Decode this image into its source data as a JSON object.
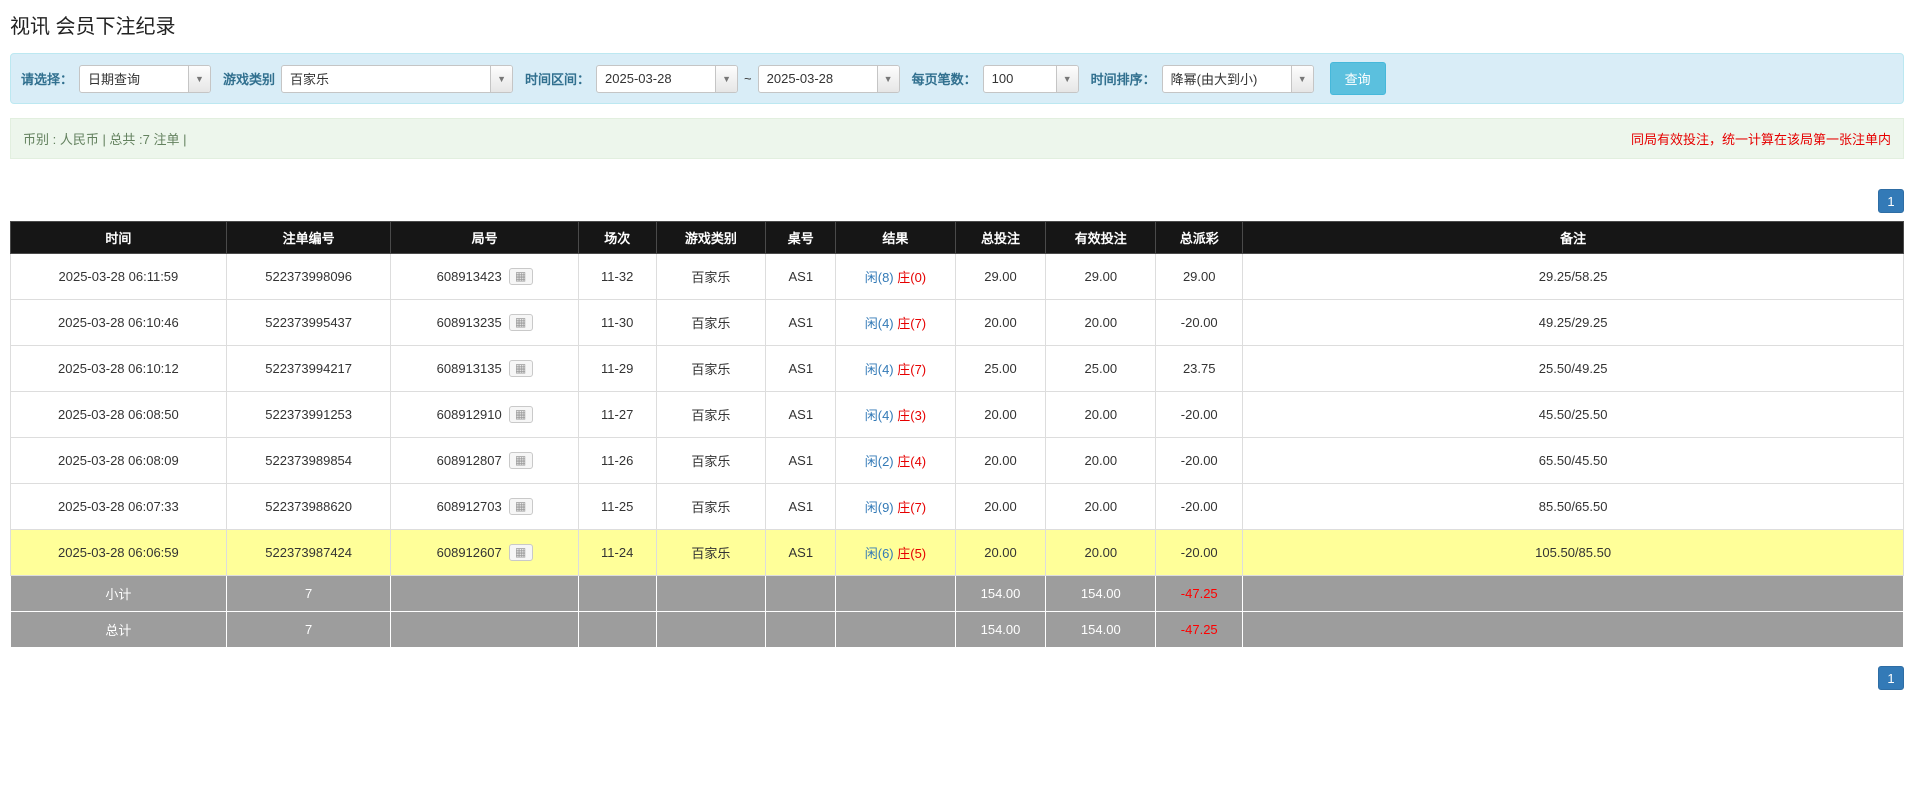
{
  "page": {
    "title": "视讯 会员下注纪录"
  },
  "filters": {
    "select_label": "请选择：",
    "select_value": "日期查询",
    "game_type_label": "游戏类别",
    "game_type_value": "百家乐",
    "time_range_label": "时间区间：",
    "date_from": "2025-03-28",
    "date_to": "2025-03-28",
    "range_separator": "~",
    "page_size_label": "每页笔数：",
    "page_size_value": "100",
    "sort_label": "时间排序：",
    "sort_value": "降幂(由大到小)",
    "query_button": "查询",
    "dropdown_icon": "▼"
  },
  "summary": {
    "left": "币别 : 人民币 | 总共 :7 注单 |",
    "right": "同局有效投注，统一计算在该局第一张注单内"
  },
  "pagination": {
    "page": "1"
  },
  "table": {
    "headers": [
      "时间",
      "注单编号",
      "局号",
      "场次",
      "游戏类别",
      "桌号",
      "结果",
      "总投注",
      "有效投注",
      "总派彩",
      "备注"
    ],
    "roadmap_icon": "▦",
    "rows": [
      {
        "time": "2025-03-28 06:11:59",
        "bet_id": "522373998096",
        "round_id": "608913423",
        "session": "11-32",
        "game": "百家乐",
        "table_no": "AS1",
        "result_player": "闲(8)",
        "result_banker": "庄(0)",
        "total_bet": "29.00",
        "valid_bet": "29.00",
        "payout": "29.00",
        "remark": "29.25/58.25",
        "highlight": false
      },
      {
        "time": "2025-03-28 06:10:46",
        "bet_id": "522373995437",
        "round_id": "608913235",
        "session": "11-30",
        "game": "百家乐",
        "table_no": "AS1",
        "result_player": "闲(4)",
        "result_banker": "庄(7)",
        "total_bet": "20.00",
        "valid_bet": "20.00",
        "payout": "-20.00",
        "remark": "49.25/29.25",
        "highlight": false
      },
      {
        "time": "2025-03-28 06:10:12",
        "bet_id": "522373994217",
        "round_id": "608913135",
        "session": "11-29",
        "game": "百家乐",
        "table_no": "AS1",
        "result_player": "闲(4)",
        "result_banker": "庄(7)",
        "total_bet": "25.00",
        "valid_bet": "25.00",
        "payout": "23.75",
        "remark": "25.50/49.25",
        "highlight": false
      },
      {
        "time": "2025-03-28 06:08:50",
        "bet_id": "522373991253",
        "round_id": "608912910",
        "session": "11-27",
        "game": "百家乐",
        "table_no": "AS1",
        "result_player": "闲(4)",
        "result_banker": "庄(3)",
        "total_bet": "20.00",
        "valid_bet": "20.00",
        "payout": "-20.00",
        "remark": "45.50/25.50",
        "highlight": false
      },
      {
        "time": "2025-03-28 06:08:09",
        "bet_id": "522373989854",
        "round_id": "608912807",
        "session": "11-26",
        "game": "百家乐",
        "table_no": "AS1",
        "result_player": "闲(2)",
        "result_banker": "庄(4)",
        "total_bet": "20.00",
        "valid_bet": "20.00",
        "payout": "-20.00",
        "remark": "65.50/45.50",
        "highlight": false
      },
      {
        "time": "2025-03-28 06:07:33",
        "bet_id": "522373988620",
        "round_id": "608912703",
        "session": "11-25",
        "game": "百家乐",
        "table_no": "AS1",
        "result_player": "闲(9)",
        "result_banker": "庄(7)",
        "total_bet": "20.00",
        "valid_bet": "20.00",
        "payout": "-20.00",
        "remark": "85.50/65.50",
        "highlight": false
      },
      {
        "time": "2025-03-28 06:06:59",
        "bet_id": "522373987424",
        "round_id": "608912607",
        "session": "11-24",
        "game": "百家乐",
        "table_no": "AS1",
        "result_player": "闲(6)",
        "result_banker": "庄(5)",
        "total_bet": "20.00",
        "valid_bet": "20.00",
        "payout": "-20.00",
        "remark": "105.50/85.50",
        "highlight": true
      }
    ],
    "subtotal": {
      "label": "小计",
      "count": "7",
      "total_bet": "154.00",
      "valid_bet": "154.00",
      "payout": "-47.25"
    },
    "total": {
      "label": "总计",
      "count": "7",
      "total_bet": "154.00",
      "valid_bet": "154.00",
      "payout": "-47.25"
    }
  }
}
